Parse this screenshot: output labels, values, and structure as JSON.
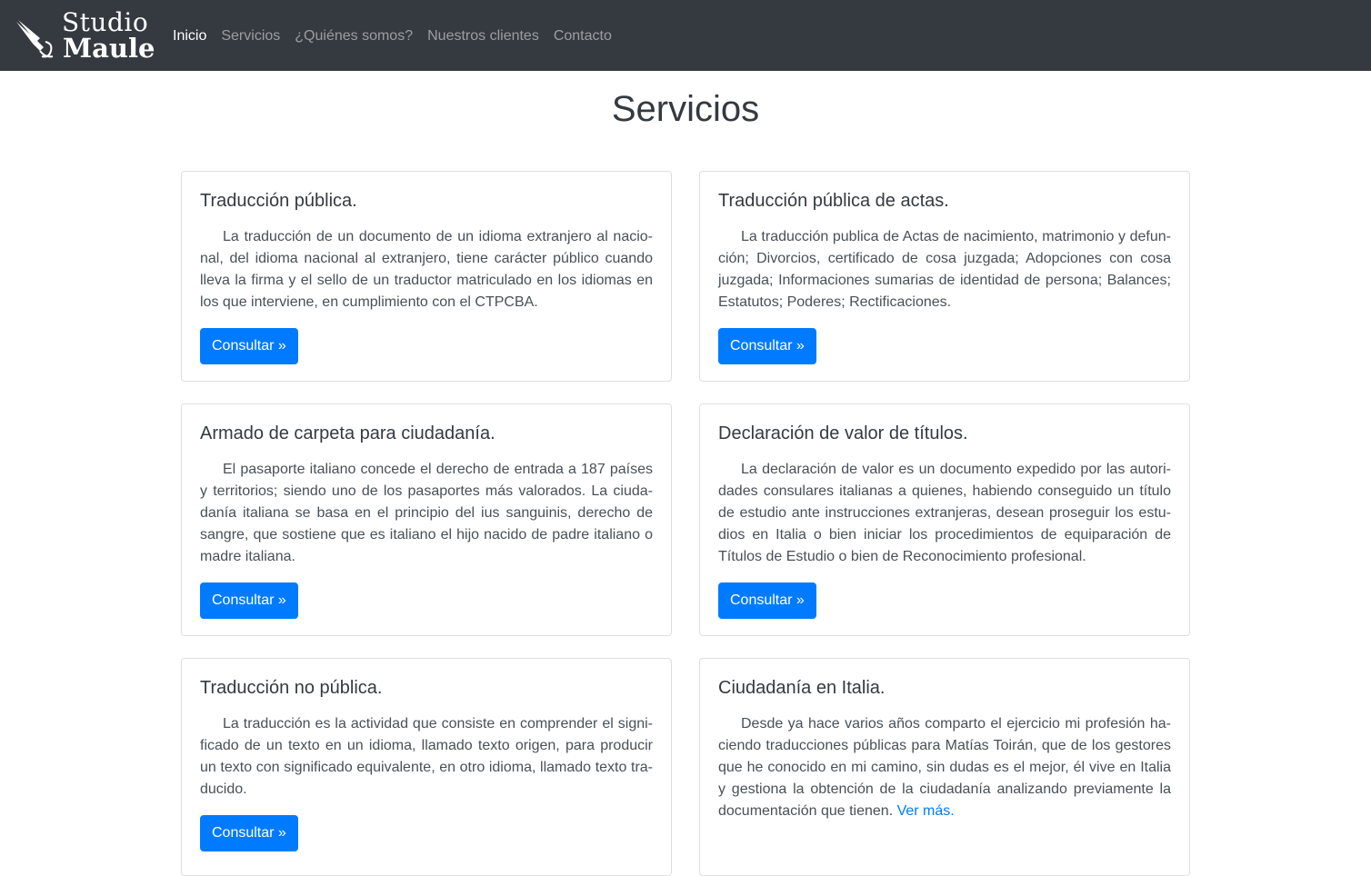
{
  "brand": {
    "line1": "Studio",
    "line2": "Maule",
    "icon": "fountain-pen-icon"
  },
  "nav": {
    "items": [
      {
        "label": "Inicio",
        "active": true
      },
      {
        "label": "Servicios",
        "active": false
      },
      {
        "label": "¿Quiénes somos?",
        "active": false
      },
      {
        "label": "Nuestros clientes",
        "active": false
      },
      {
        "label": "Contacto",
        "active": false
      }
    ]
  },
  "page": {
    "title": "Servicios"
  },
  "cards": [
    {
      "title": "Traducción pública.",
      "text": "La traducción de un documento de un idioma extranjero al nacio­nal, del idioma nacional al extranjero, tiene carácter público cuando lleva la firma y el sello de un traductor matriculado en los idiomas en los que interviene, en cumplimiento con el CTPCBA.",
      "button": "Consultar »"
    },
    {
      "title": "Traducción pública de actas.",
      "text": "La traducción publica de Actas de nacimiento, matrimonio y defun­ción; Divorcios, certificado de cosa juzgada; Adopciones con cosa juzgada; Informaciones sumarias de identidad de persona; Balances; Estatutos; Poderes; Rectificaciones.",
      "button": "Consultar »"
    },
    {
      "title": "Armado de carpeta para ciudadanía.",
      "text": "El pasaporte italiano concede el derecho de entrada a 187 países y territorios; siendo uno de los pasaportes más valorados. La ciuda­danía italiana se basa en el principio del ius sanguinis, derecho de sangre, que sostiene que es italiano el hijo nacido de padre italiano o madre italiana.",
      "button": "Consultar »"
    },
    {
      "title": "Declaración de valor de títulos.",
      "text": "La declaración de valor es un documento expedido por las autori­dades consulares italianas a quienes, habiendo conseguido un título de estudio ante instrucciones extranjeras, desean proseguir los estu­dios en Italia o bien iniciar los procedimientos de equiparación de Títulos de Estudio o bien de Reconocimiento profesional.",
      "button": "Consultar »"
    },
    {
      "title": "Traducción no pública.",
      "text": "La traducción es la actividad que consiste en comprender el signi­ficado de un texto en un idioma, llamado texto origen, para producir un texto con significado equivalente, en otro idioma, llamado texto tra­ducido.",
      "button": "Consultar »"
    },
    {
      "title": "Ciudadanía en Italia.",
      "text": "Desde ya hace varios años comparto el ejercicio mi profesión ha­ciendo traducciones públicas para Matías Toirán, que de los gestores que he conocido en mi camino, sin dudas es el mejor, él vive en Italia y gestiona la obtención de la ciudadanía analizando previamente la documentación que tienen.",
      "link": "Ver más."
    }
  ],
  "colors": {
    "navbar": "#343a40",
    "primary": "#007bff"
  }
}
